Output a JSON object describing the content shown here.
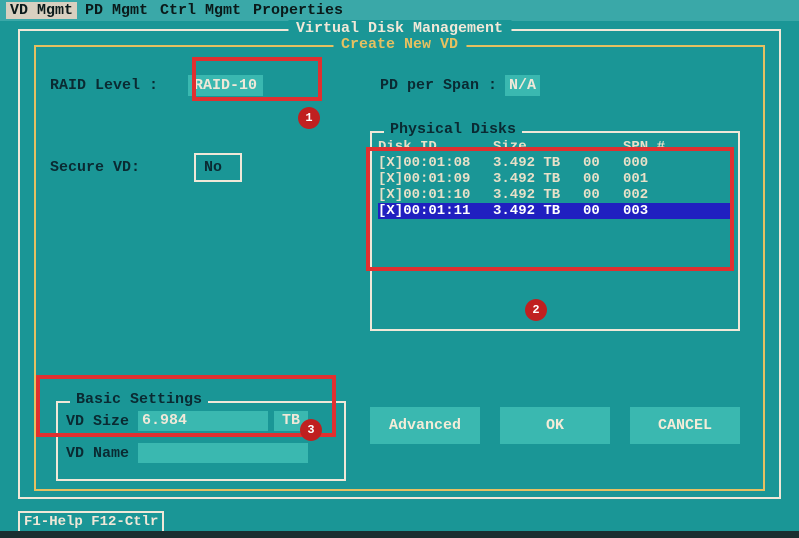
{
  "menu": {
    "items": [
      "VD Mgmt",
      "PD Mgmt",
      "Ctrl Mgmt",
      "Properties"
    ],
    "active_index": 0
  },
  "outer_title": "Virtual Disk Management",
  "inner_title": "Create New VD",
  "raid": {
    "label": "RAID Level  :",
    "value": "RAID-10"
  },
  "pdspan": {
    "label": "PD per Span :",
    "value": "N/A"
  },
  "secure": {
    "label": "Secure VD:",
    "value": "No"
  },
  "pd_box": {
    "title": "Physical Disks",
    "headers": [
      "Disk ID",
      "Size",
      "",
      "SPN #"
    ],
    "rows": [
      {
        "id": "[X]00:01:08",
        "size": "3.492 TB",
        "c3": "00",
        "spn": "000",
        "selected": false
      },
      {
        "id": "[X]00:01:09",
        "size": "3.492 TB",
        "c3": "00",
        "spn": "001",
        "selected": false
      },
      {
        "id": "[X]00:01:10",
        "size": "3.492 TB",
        "c3": "00",
        "spn": "002",
        "selected": false
      },
      {
        "id": "[X]00:01:11",
        "size": "3.492 TB",
        "c3": "00",
        "spn": "003",
        "selected": true
      }
    ]
  },
  "basic": {
    "title": "Basic Settings",
    "size_label": "VD Size",
    "size_value": "6.984",
    "size_unit": "TB",
    "name_label": "VD Name",
    "name_value": ""
  },
  "buttons": {
    "advanced": "Advanced",
    "ok": "OK",
    "cancel": "CANCEL"
  },
  "footer": "F1-Help F12-Ctlr",
  "annotations": {
    "badge1": "1",
    "badge2": "2",
    "badge3": "3"
  }
}
